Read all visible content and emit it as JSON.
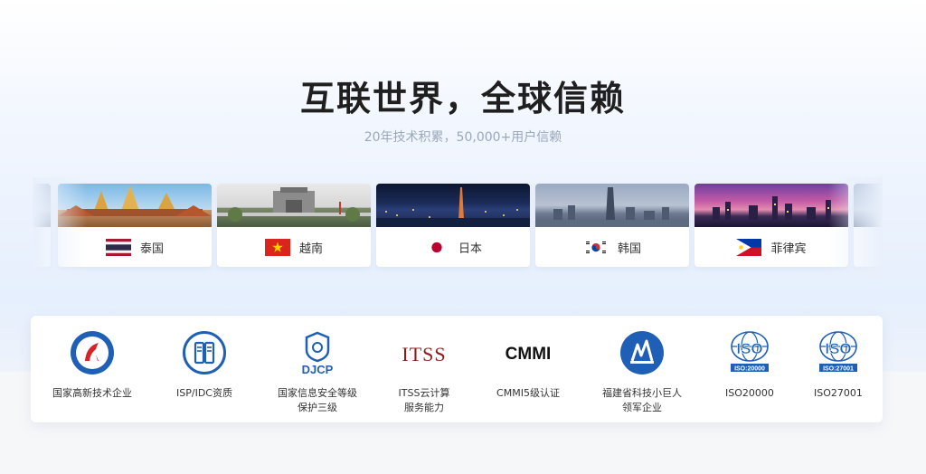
{
  "hero": {
    "title": "互联世界，全球信赖",
    "subtitle": "20年技术积累，50,000+用户信赖"
  },
  "countries": [
    {
      "name": "泰国",
      "flag": "thailand-flag-icon"
    },
    {
      "name": "越南",
      "flag": "vietnam-flag-icon"
    },
    {
      "name": "日本",
      "flag": "japan-flag-icon"
    },
    {
      "name": "韩国",
      "flag": "korea-flag-icon"
    },
    {
      "name": "菲律宾",
      "flag": "philippines-flag-icon"
    }
  ],
  "certifications": [
    {
      "name": "国家高新技术企业",
      "icon": "high-tech-enterprise-icon"
    },
    {
      "name": "ISP/IDC资质",
      "icon": "isp-idc-server-icon"
    },
    {
      "name": "国家信息安全等级\n保护三级",
      "icon": "djcp-shield-icon",
      "logo_text": "DJCP"
    },
    {
      "name": "ITSS云计算\n服务能力",
      "icon": "itss-logo",
      "logo_text": "ITSS"
    },
    {
      "name": "CMMI5级认证",
      "icon": "cmmi-logo",
      "logo_text": "CMMI"
    },
    {
      "name": "福建省科技小巨人\n领军企业",
      "icon": "fujian-tech-giant-icon"
    },
    {
      "name": "ISO20000",
      "icon": "iso-globe-icon",
      "logo_text": "ISO",
      "logo_sub": "ISO:20000"
    },
    {
      "name": "ISO27001",
      "icon": "iso-globe-icon",
      "logo_text": "ISO",
      "logo_sub": "ISO:27001"
    }
  ],
  "colors": {
    "accent_blue": "#1f5fb5",
    "itss_red": "#8b1a1a",
    "subtitle": "#9aa8bd"
  }
}
